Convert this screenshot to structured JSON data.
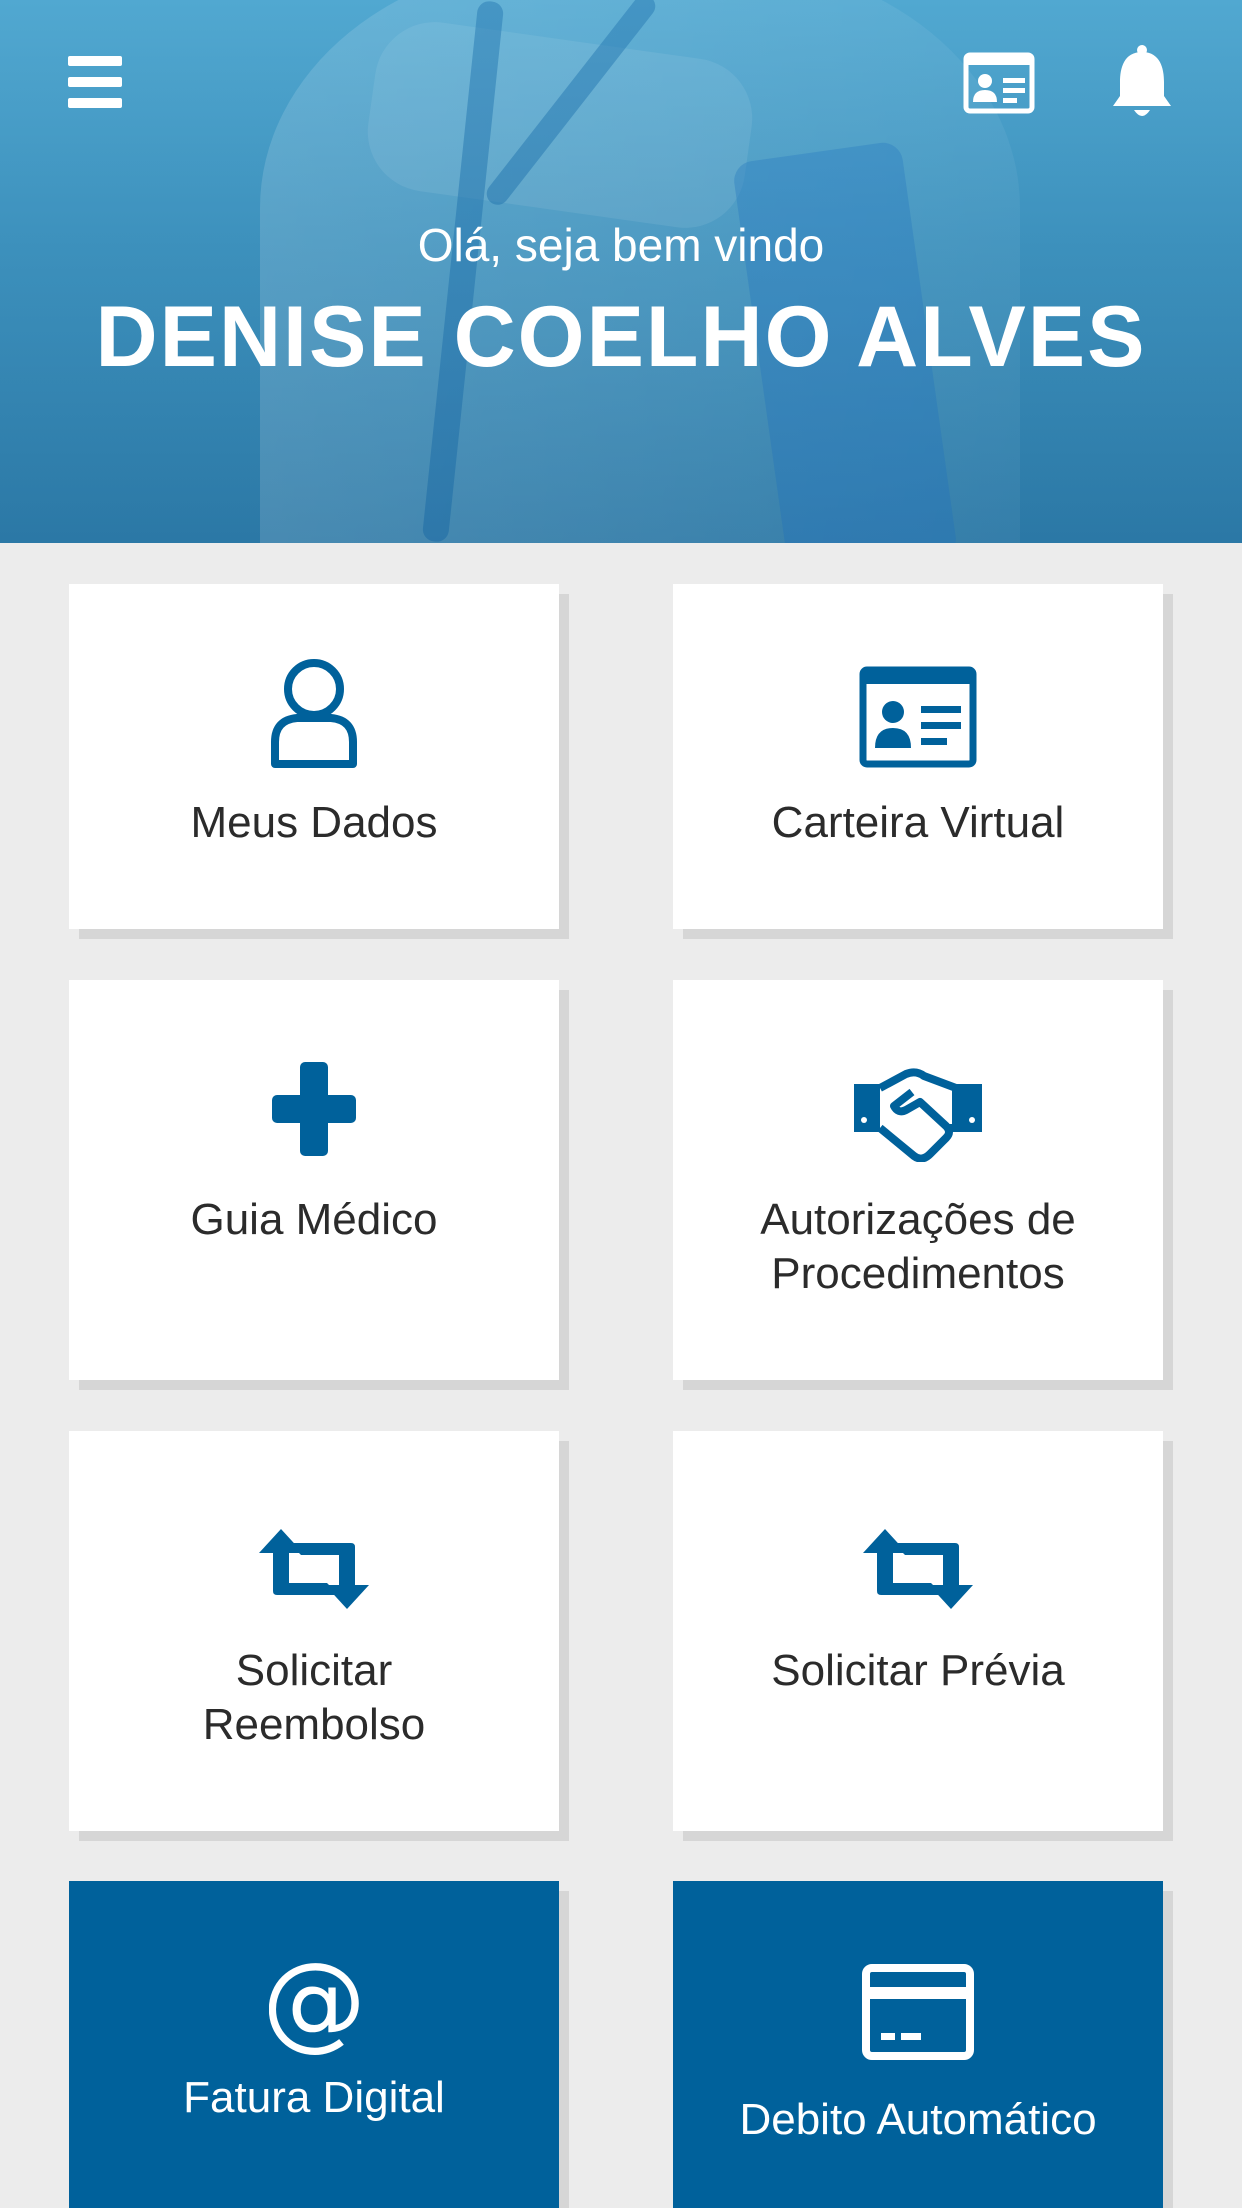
{
  "header": {
    "greeting": "Olá, seja bem vindo",
    "user_name": "DENISE COELHO ALVES",
    "menu_icon": "hamburger-menu-icon",
    "card_icon": "id-card-icon",
    "notification_icon": "bell-icon"
  },
  "colors": {
    "accent": "#00619b",
    "header_top": "#4ea4cd",
    "header_bottom": "#2f7daa",
    "background": "#ececec",
    "tile": "#ffffff",
    "tile_dark": "#00619b",
    "text": "#2b2b2b"
  },
  "tiles": [
    {
      "label": "Meus Dados",
      "icon": "user-icon"
    },
    {
      "label": "Carteira Virtual",
      "icon": "id-card-icon"
    },
    {
      "label": "Guia Médico",
      "icon": "plus-icon"
    },
    {
      "label_line1": "Autorizações de",
      "label_line2": "Procedimentos",
      "icon": "handshake-icon"
    },
    {
      "label_line1": "Solicitar",
      "label_line2": "Reembolso",
      "icon": "retweet-icon"
    },
    {
      "label": "Solicitar Prévia",
      "icon": "retweet-icon"
    },
    {
      "label": "Fatura Digital",
      "icon": "at-sign-icon"
    },
    {
      "label": "Debito Automático",
      "icon": "credit-card-icon"
    }
  ]
}
